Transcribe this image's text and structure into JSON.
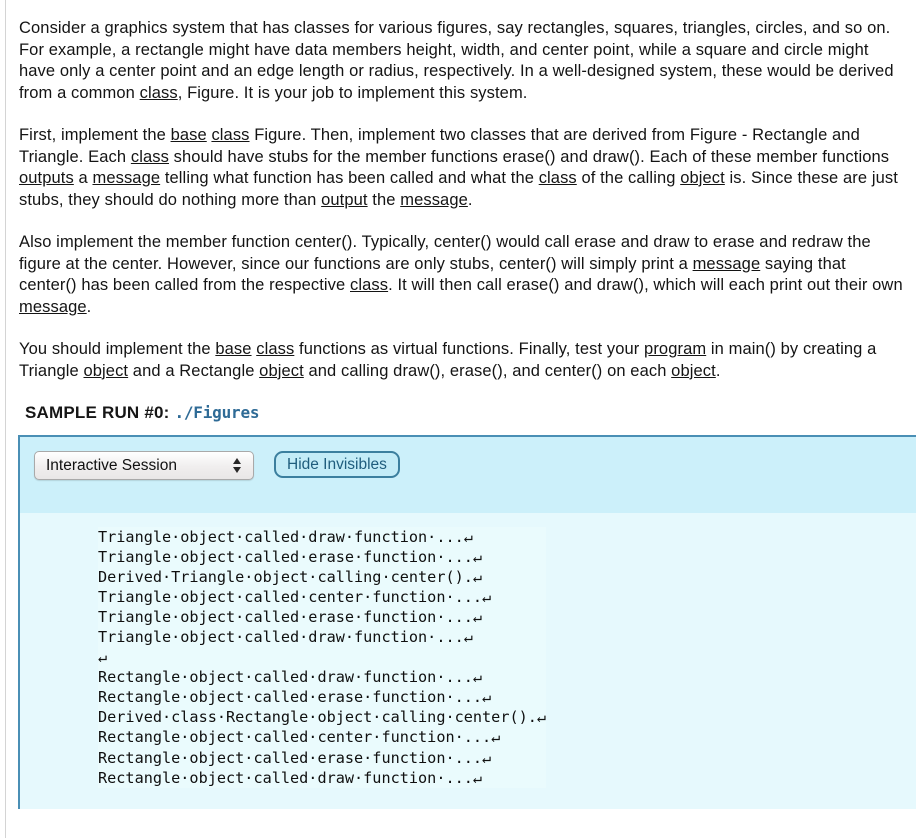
{
  "document": {
    "paragraphs": [
      {
        "id": "p1",
        "runs": [
          {
            "t": "Consider a graphics system that has classes for various figures, say rectangles, squares, triangles, circles, and so on. For example, a rectangle might have data members height, width, and center point, while a square and circle might have only a center point and an edge length or radius, respectively. In a well-designed system, these would be derived from a common ",
            "link": false
          },
          {
            "t": "class",
            "link": true
          },
          {
            "t": ", Figure. It is your job to implement this system.",
            "link": false
          }
        ]
      },
      {
        "id": "p2",
        "runs": [
          {
            "t": "First, implement the ",
            "link": false
          },
          {
            "t": "base",
            "link": true
          },
          {
            "t": " ",
            "link": false
          },
          {
            "t": "class",
            "link": true
          },
          {
            "t": " Figure. Then, implement two classes that are derived from Figure - Rectangle and Triangle. Each ",
            "link": false
          },
          {
            "t": "class",
            "link": true
          },
          {
            "t": " should have stubs for the member functions erase() and draw(). Each of these member functions ",
            "link": false
          },
          {
            "t": "outputs",
            "link": true
          },
          {
            "t": " a ",
            "link": false
          },
          {
            "t": "message",
            "link": true
          },
          {
            "t": " telling what function has been called and what the ",
            "link": false
          },
          {
            "t": "class",
            "link": true
          },
          {
            "t": " of the calling ",
            "link": false
          },
          {
            "t": "object",
            "link": true
          },
          {
            "t": " is. Since these are just stubs, they should do nothing more than ",
            "link": false
          },
          {
            "t": "output",
            "link": true
          },
          {
            "t": " the ",
            "link": false
          },
          {
            "t": "message",
            "link": true
          },
          {
            "t": ".",
            "link": false
          }
        ]
      },
      {
        "id": "p3",
        "runs": [
          {
            "t": "Also implement the member function center(). Typically, center() would call erase and draw to erase and redraw the figure at the center. However, since our functions are only stubs, center() will simply print a ",
            "link": false
          },
          {
            "t": "message",
            "link": true
          },
          {
            "t": " saying that center() has been called from the respective ",
            "link": false
          },
          {
            "t": "class",
            "link": true
          },
          {
            "t": ". It will then call erase() and draw(), which will each print out their own ",
            "link": false
          },
          {
            "t": "message",
            "link": true
          },
          {
            "t": ".",
            "link": false
          }
        ]
      },
      {
        "id": "p4",
        "runs": [
          {
            "t": "You should implement the ",
            "link": false
          },
          {
            "t": "base",
            "link": true
          },
          {
            "t": " ",
            "link": false
          },
          {
            "t": "class",
            "link": true
          },
          {
            "t": " functions as virtual functions. Finally, test your ",
            "link": false
          },
          {
            "t": "program",
            "link": true
          },
          {
            "t": " in main() by creating a Triangle ",
            "link": false
          },
          {
            "t": "object",
            "link": true
          },
          {
            "t": " and a Rectangle ",
            "link": false
          },
          {
            "t": "object",
            "link": true
          },
          {
            "t": " and calling draw(), erase(), and center() on each ",
            "link": false
          },
          {
            "t": "object",
            "link": true
          },
          {
            "t": ".",
            "link": false
          }
        ]
      }
    ]
  },
  "sample_run": {
    "label": "SAMPLE RUN #0:",
    "command": "./Figures",
    "command_color": "#2f6b96"
  },
  "terminal": {
    "mode_select": {
      "selected": "Interactive Session",
      "options": [
        "Interactive Session"
      ]
    },
    "toggle_button": {
      "label": "Hide Invisibles"
    },
    "output_text": "Triangle·object·called·draw·function·...↵\nTriangle·object·called·erase·function·...↵\nDerived·Triangle·object·calling·center().↵\nTriangle·object·called·center·function·...↵\nTriangle·object·called·erase·function·...↵\nTriangle·object·called·draw·function·...↵\n↵\nRectangle·object·called·draw·function·...↵\nRectangle·object·called·erase·function·...↵\nDerived·class·Rectangle·object·calling·center().↵\nRectangle·object·called·center·function·...↵\nRectangle·object·called·erase·function·...↵\nRectangle·object·called·draw·function·...↵",
    "colors": {
      "header_band": "#ccf0fa",
      "body": "#e6f9fd",
      "pre_block": "#eafbfd",
      "border": "#4a8fb5"
    }
  }
}
